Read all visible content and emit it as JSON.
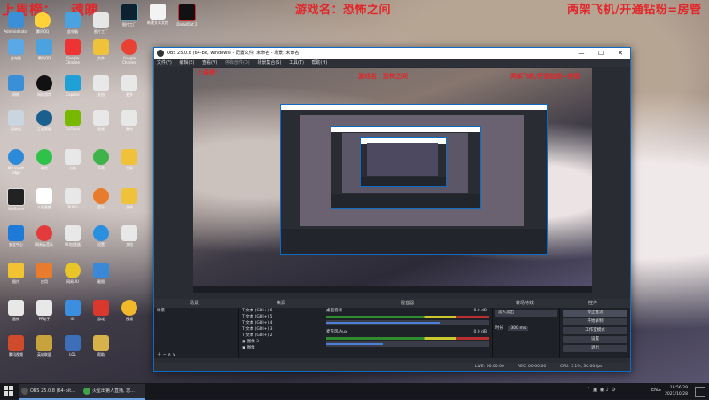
{
  "overlay": {
    "left_label": "上周榜：",
    "left_name": "魂魄",
    "game_label": "游戏名：恐怖之间",
    "right_label": "两架飞机/开通钻粉=房管"
  },
  "desktop_icons": {
    "top_row": [
      "Administrator",
      "腾讯QQ",
      "此电脑",
      "图片工厂",
      "新建文本文档",
      "DreadOut 2"
    ],
    "col1": [
      "此电脑",
      "网络",
      "回收站",
      "控制面板",
      "Microsoft Edge",
      "WeGame",
      "Microsoft Store",
      "安全中心",
      "爱奇艺",
      "图片",
      "雷神",
      "腾讯视频"
    ],
    "col2": [
      "腾讯QQ",
      "网络游戏",
      "APP",
      "王者荣耀",
      "YY语音",
      "微信",
      "斗鱼直播",
      "网易云音乐",
      "QQ音乐",
      "应用",
      "PP助手",
      "英雄联盟"
    ],
    "col3": [
      "图片",
      "文件夹",
      "Google Chrome",
      "Caprice",
      "GeForce",
      "Experience",
      "小鱼",
      "PUBG",
      "UU加速器",
      "网易UU",
      "IIS",
      "LOL"
    ],
    "col4": [
      "文件",
      "文档",
      "视频",
      "下载",
      "音乐",
      "设置",
      "截图",
      "游戏",
      "帮助",
      "更多",
      "素材",
      "工具"
    ]
  },
  "obs": {
    "title": "OBS 25.0.8 (64-bit, windows) - 配置文件: 未命名 - 场景: 未命名",
    "menu": [
      "文件(F)",
      "编辑(E)",
      "查看(V)",
      "停靠部件(D)",
      "场景集合(S)",
      "工具(T)",
      "帮助(H)"
    ],
    "docks": {
      "scenes_title": "场景",
      "sources_title": "来源",
      "mixer_title": "混音器",
      "transitions_title": "转场特效",
      "controls_title": "控件"
    },
    "scenes": [
      "场景"
    ],
    "sources": [
      "文本 (GDI+) 6",
      "文本 (GDI+) 5",
      "文本 (GDI+) 4",
      "文本 (GDI+) 3",
      "文本 (GDI+) 2",
      "图像 3",
      "图像"
    ],
    "mixer": [
      {
        "name": "桌面音频",
        "db": "0.0 dB",
        "level": 0.7
      },
      {
        "name": "麦克风/Aux",
        "db": "0.0 dB",
        "level": 0.35
      }
    ],
    "transitions": {
      "label": "淡入淡出",
      "duration_label": "时长",
      "duration_value": "300 ms"
    },
    "controls": [
      "停止推流",
      "开始录制",
      "工作室模式",
      "设置",
      "退出"
    ],
    "status": {
      "live": "LIVE: 00:00:00",
      "rec": "REC: 00:00:00",
      "cpu": "CPU: 5.1%, 30.00 fps"
    }
  },
  "taskbar": {
    "items": [
      "OBS 25.0.8 (64-bit...",
      "火星出第人直播, 您..."
    ],
    "lang": "ENG",
    "time": "19:56:29",
    "date": "2021/10/28"
  },
  "colors": {
    "accent": "#0e6cc4",
    "overlay_red": "#e3262a"
  }
}
